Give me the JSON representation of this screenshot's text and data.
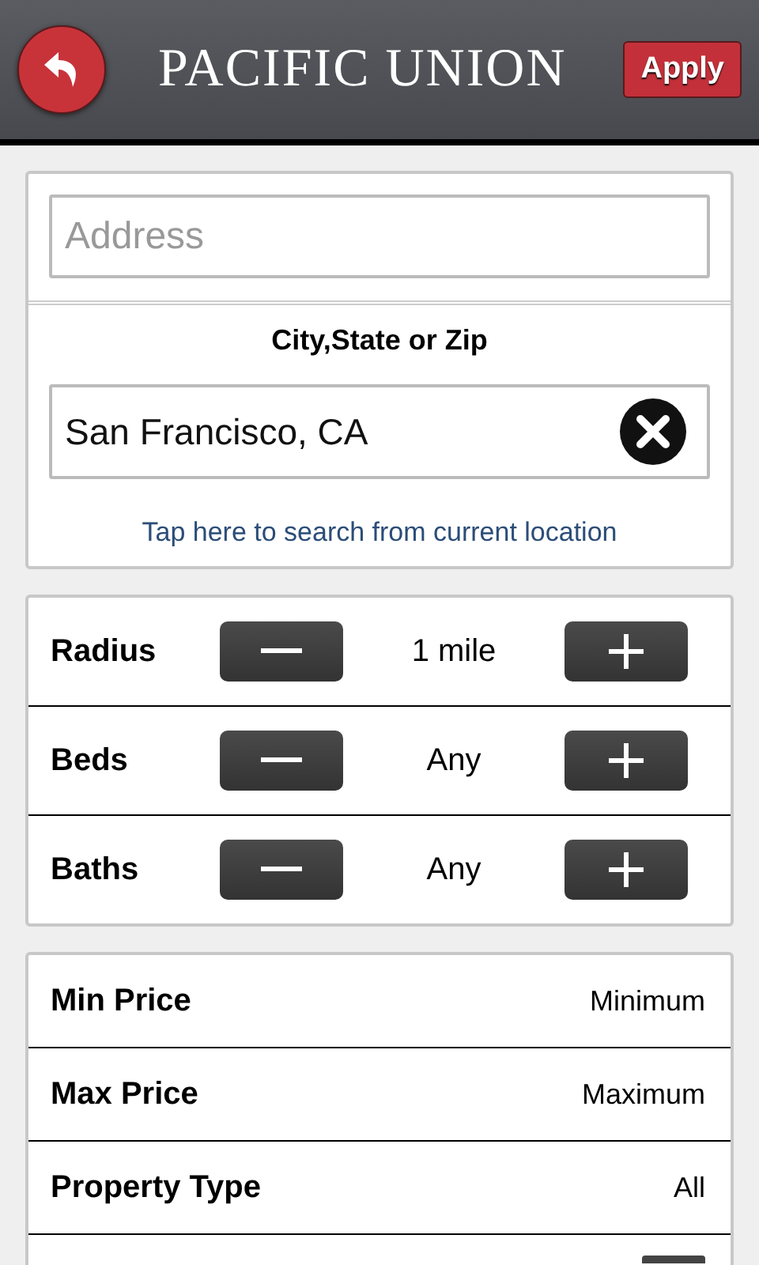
{
  "header": {
    "logo": "PACIFIC UNION",
    "apply": "Apply"
  },
  "location": {
    "address": {
      "placeholder": "Address"
    },
    "city_label": "City,State or Zip",
    "city": {
      "value": "San Francisco, CA"
    },
    "current_location_link": "Tap here to search from current location"
  },
  "steppers": [
    {
      "label": "Radius",
      "value": "1 mile"
    },
    {
      "label": "Beds",
      "value": "Any"
    },
    {
      "label": "Baths",
      "value": "Any"
    }
  ],
  "options": [
    {
      "kind": "value",
      "label": "Min Price",
      "value": "Minimum"
    },
    {
      "kind": "value",
      "label": "Max Price",
      "value": "Maximum"
    },
    {
      "kind": "value",
      "label": "Property Type",
      "value": "All"
    },
    {
      "kind": "switch"
    }
  ]
}
